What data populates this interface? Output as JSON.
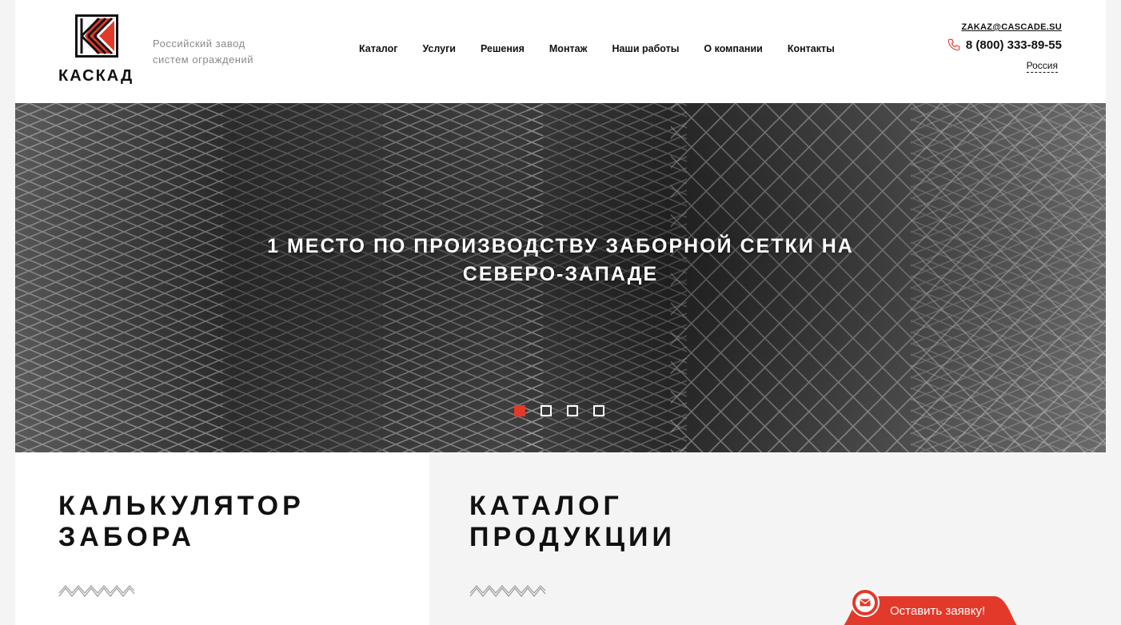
{
  "brand": {
    "name": "КАСКАД",
    "tagline_line1": "Российский завод",
    "tagline_line2": "систем ограждений",
    "accent_color": "#e2392b"
  },
  "nav": {
    "items": [
      {
        "label": "Каталог"
      },
      {
        "label": "Услуги"
      },
      {
        "label": "Решения"
      },
      {
        "label": "Монтаж"
      },
      {
        "label": "Наши работы"
      },
      {
        "label": "О компании"
      },
      {
        "label": "Контакты"
      }
    ]
  },
  "contacts": {
    "email": "ZAKAZ@CASCADE.SU",
    "phone": "8 (800) 333-89-55",
    "region": "Россия",
    "phone_icon": "phone-icon"
  },
  "hero": {
    "title_line1": "1 МЕСТО ПО ПРОИЗВОДСТВУ ЗАБОРНОЙ СЕТКИ НА",
    "title_line2": "СЕВЕРО-ЗАПАДЕ",
    "slides_total": 4,
    "active_slide": 1
  },
  "sections": {
    "calculator": {
      "line1": "КАЛЬКУЛЯТОР",
      "line2": "ЗАБОРА"
    },
    "catalog": {
      "line1": "КАТАЛОГ",
      "line2": "ПРОДУКЦИИ"
    }
  },
  "request_button": {
    "label": "Оставить заявку!",
    "icon": "envelope-icon"
  }
}
